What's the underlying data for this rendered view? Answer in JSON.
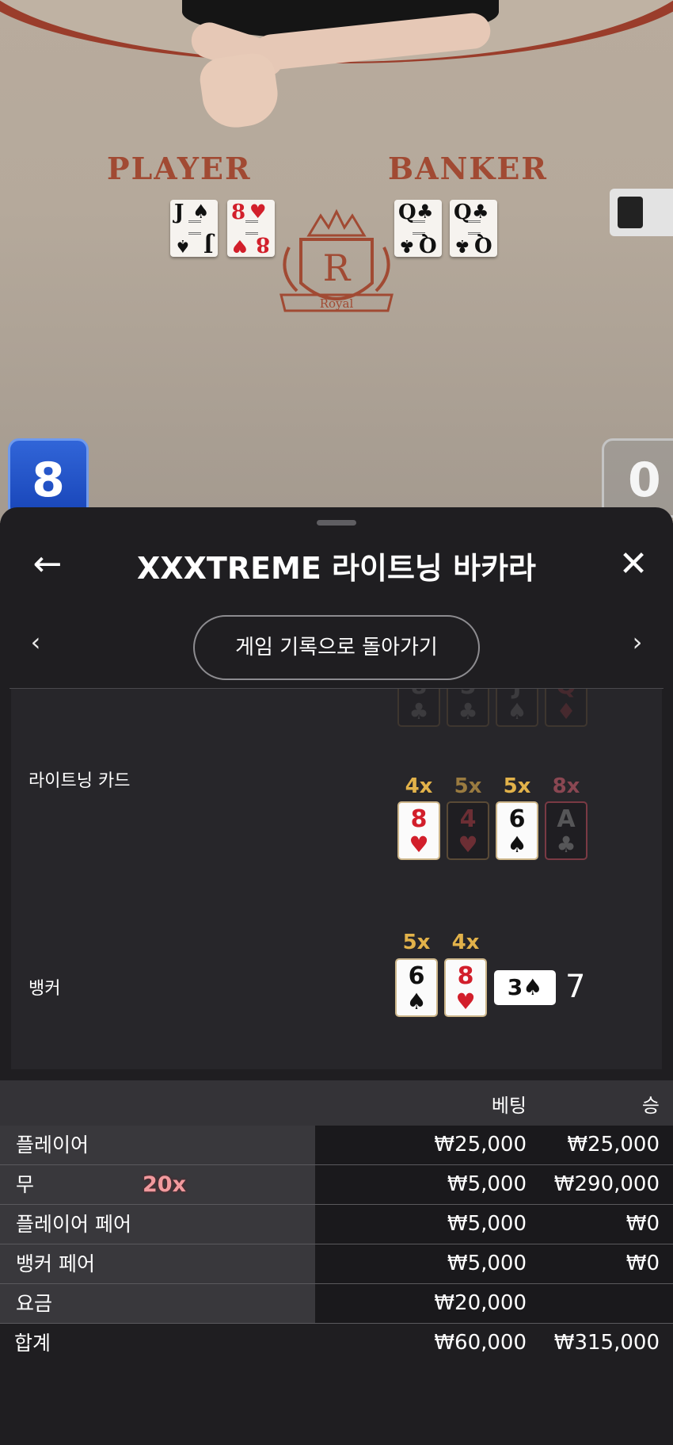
{
  "video": {
    "player_label": "PLAYER",
    "banker_label": "BANKER",
    "crest_letter": "R",
    "crest_text": "Royal",
    "player_cards": [
      {
        "rank": "J",
        "suit": "♠",
        "color": "black"
      },
      {
        "rank": "8",
        "suit": "♥",
        "color": "red"
      }
    ],
    "banker_cards": [
      {
        "rank": "Q",
        "suit": "♣",
        "color": "black"
      },
      {
        "rank": "Q",
        "suit": "♣",
        "color": "black"
      }
    ],
    "player_score": "8",
    "banker_score": "0"
  },
  "panel": {
    "title": "XXXTREME 라이트닝 바카라",
    "back_icon": "arrow-left-icon",
    "close_icon": "close-icon",
    "history_button": "게임 기록으로 돌아가기",
    "prev_icon": "chevron-left-icon",
    "next_icon": "chevron-right-icon"
  },
  "result": {
    "top_partial_cards": [
      {
        "rank": "8",
        "suit": "♣",
        "color": "black"
      },
      {
        "rank": "5",
        "suit": "♣",
        "color": "black"
      },
      {
        "rank": "J",
        "suit": "♠",
        "color": "black"
      },
      {
        "rank": "Q",
        "suit": "♦",
        "color": "red"
      }
    ],
    "lightning_label": "라이트닝 카드",
    "lightning_cards": [
      {
        "mult": "4x",
        "rank": "8",
        "suit": "♥",
        "color": "red",
        "state": "active"
      },
      {
        "mult": "5x",
        "rank": "4",
        "suit": "♥",
        "color": "red",
        "state": "dim"
      },
      {
        "mult": "5x",
        "rank": "6",
        "suit": "♠",
        "color": "black",
        "state": "active"
      },
      {
        "mult": "8x",
        "rank": "A",
        "suit": "♣",
        "color": "black",
        "state": "dim"
      }
    ],
    "banker_label": "뱅커",
    "banker_cards": [
      {
        "mult": "5x",
        "rank": "6",
        "suit": "♠",
        "color": "black"
      },
      {
        "mult": "4x",
        "rank": "8",
        "suit": "♥",
        "color": "red"
      }
    ],
    "banker_third_card": {
      "rank": "3",
      "suit": "♠"
    },
    "banker_total": "7"
  },
  "bets": {
    "col_bet": "베팅",
    "col_win": "승",
    "rows": [
      {
        "label": "플레이어",
        "bet": "₩25,000",
        "win": "₩25,000",
        "mult": ""
      },
      {
        "label": "무",
        "bet": "₩5,000",
        "win": "₩290,000",
        "mult": "20x"
      },
      {
        "label": "플레이어 페어",
        "bet": "₩5,000",
        "win": "₩0",
        "mult": ""
      },
      {
        "label": "뱅커 페어",
        "bet": "₩5,000",
        "win": "₩0",
        "mult": ""
      },
      {
        "label": "요금",
        "bet": "₩20,000",
        "win": "",
        "mult": ""
      }
    ],
    "total": {
      "label": "합계",
      "bet": "₩60,000",
      "win": "₩315,000"
    }
  }
}
